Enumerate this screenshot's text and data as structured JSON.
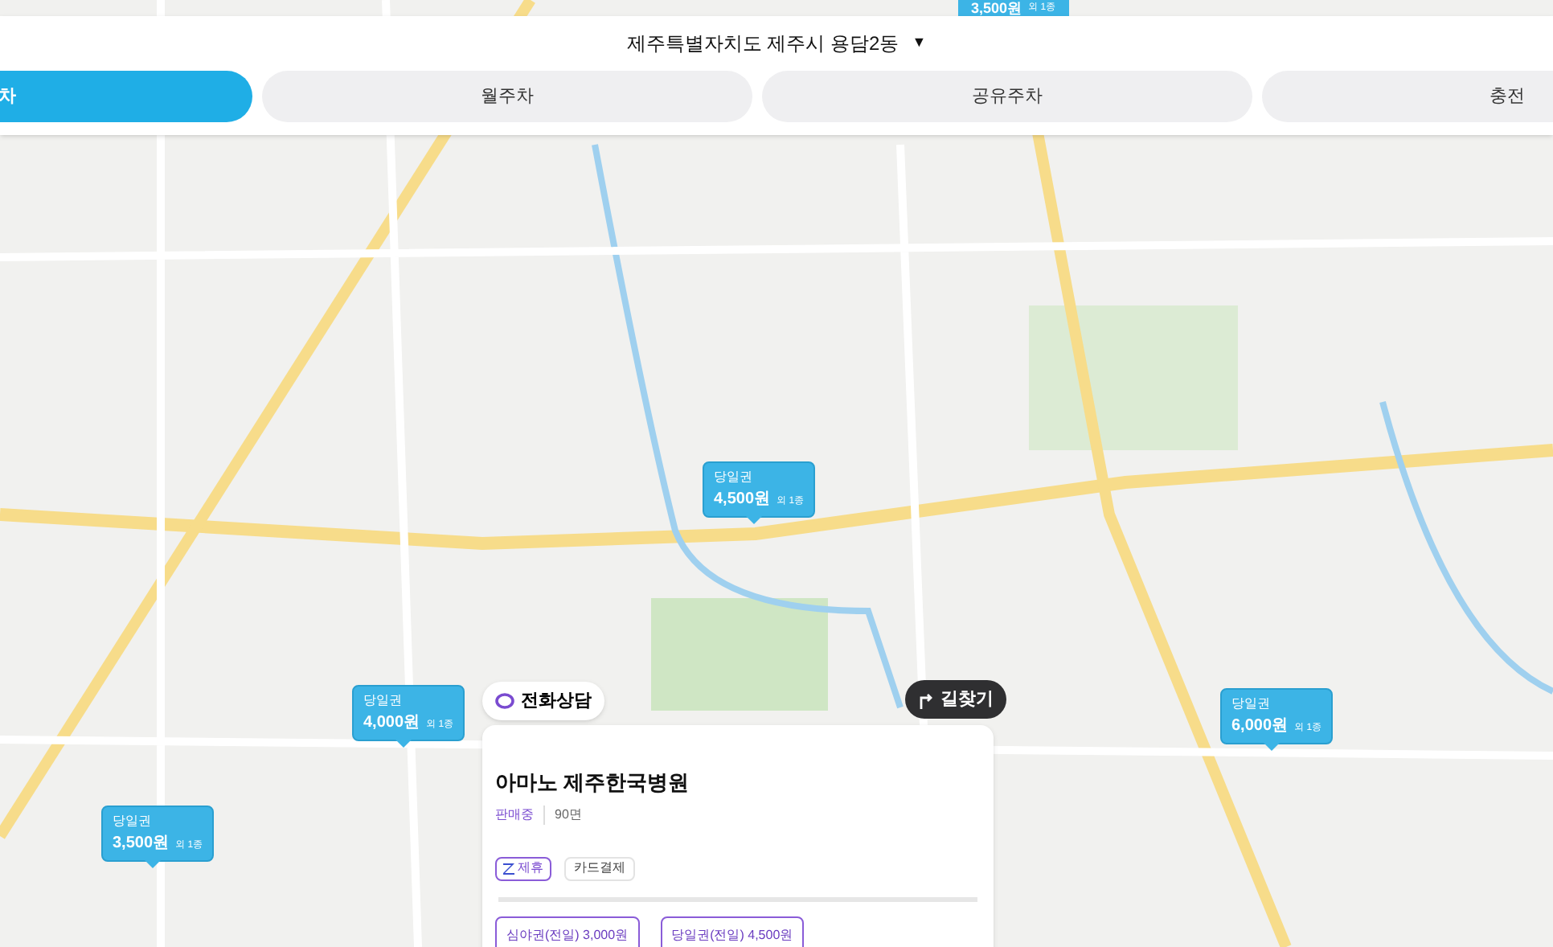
{
  "location_selector": {
    "label": "제주특별자치도 제주시 용담2동",
    "caret": "▼"
  },
  "tabs": [
    {
      "label": "차",
      "selected": true
    },
    {
      "label": "월주차",
      "selected": false
    },
    {
      "label": "공유주차",
      "selected": false
    },
    {
      "label": "충전",
      "selected": false
    }
  ],
  "price_pins": [
    {
      "ticket": "당일권",
      "price": "4,500원",
      "extra": "외 1종"
    },
    {
      "ticket": "당일권",
      "price": "4,000원",
      "extra": "외 1종"
    },
    {
      "ticket": "당일권",
      "price": "3,500원",
      "extra": "외 1종"
    },
    {
      "ticket": "당일권",
      "price": "6,000원",
      "extra": "외 1종"
    }
  ],
  "top_pin": {
    "price": "3,500원",
    "extra": "외 1종"
  },
  "call_button": {
    "label": "전화상담"
  },
  "directions_button": {
    "label": "길찾기"
  },
  "parking_card": {
    "title": "아마노 제주한국병원",
    "status": "판매중",
    "spaces": "90면",
    "tags": [
      {
        "kind": "partner",
        "label": "제휴"
      },
      {
        "kind": "plain",
        "label": "카드결제"
      }
    ],
    "tickets": [
      "심야권(전일) 3,000원",
      "당일권(전일) 4,500원"
    ]
  }
}
